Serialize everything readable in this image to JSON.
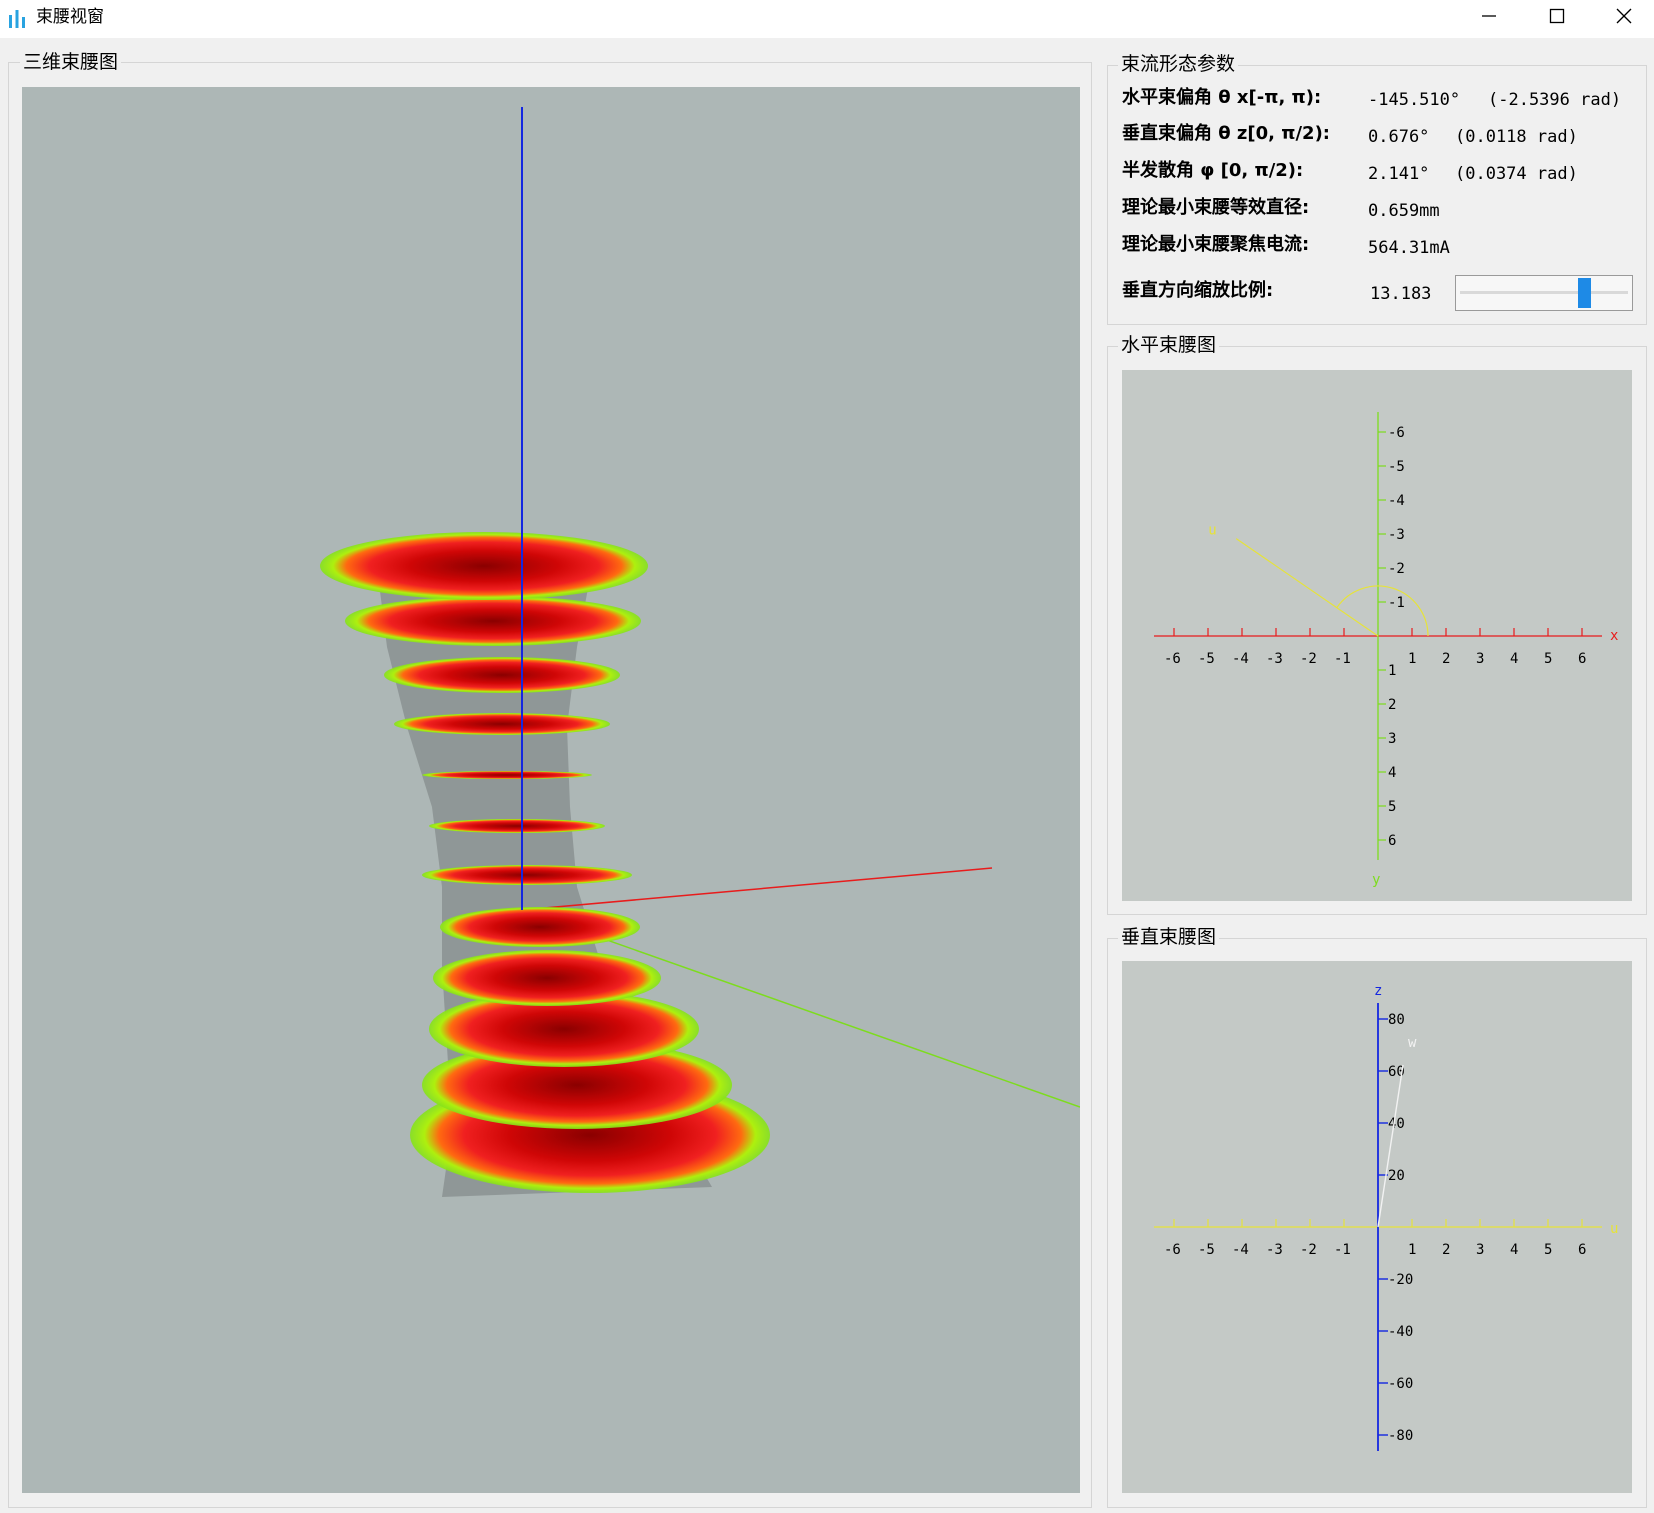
{
  "window": {
    "title": "束腰视窗",
    "icon": "bar-chart-icon",
    "controls": [
      "minimize-icon",
      "maximize-icon",
      "close-icon"
    ]
  },
  "view3d": {
    "group_title": "三维束腰图"
  },
  "params": {
    "group_title": "束流形态参数",
    "rows": [
      {
        "label": "水平束偏角 θ x[-π, π):",
        "value": "-145.510°",
        "rad": "(-2.5396 rad)"
      },
      {
        "label": "垂直束偏角 θ z[0, π/2):",
        "value": "0.676°",
        "rad": "(0.0118 rad)"
      },
      {
        "label": "半发散角 φ [0, π/2):",
        "value": "2.141°",
        "rad": "(0.0374 rad)"
      },
      {
        "label": "理论最小束腰等效直径:",
        "value": "0.659mm",
        "rad": ""
      },
      {
        "label": "理论最小束腰聚焦电流:",
        "value": "564.31mA",
        "rad": ""
      }
    ],
    "scale": {
      "label": "垂直方向缩放比例:",
      "value": "13.183",
      "slider_fraction": 0.8
    }
  },
  "horizontal_chart": {
    "group_title": "水平束腰图",
    "x_axis_label": "x",
    "y_axis_label": "y",
    "beam_label": "u",
    "beam_angle_deg": -145.51,
    "x_ticks": [
      -6,
      -5,
      -4,
      -3,
      -2,
      -1,
      1,
      2,
      3,
      4,
      5,
      6
    ],
    "y_ticks_up": [
      -1,
      -2,
      -3,
      -4,
      -5,
      -6
    ],
    "y_ticks_down": [
      1,
      2,
      3,
      4,
      5,
      6
    ]
  },
  "vertical_chart": {
    "group_title": "垂直束腰图",
    "h_axis_label": "u",
    "z_axis_label": "z",
    "beam_label": "w",
    "beam_angle_deg": 0.676,
    "x_ticks": [
      -6,
      -5,
      -4,
      -3,
      -2,
      -1,
      1,
      2,
      3,
      4,
      5,
      6
    ],
    "z_ticks_up": [
      20,
      40,
      60,
      80
    ],
    "z_ticks_down": [
      -20,
      -40,
      -60,
      -80
    ]
  },
  "colors": {
    "viewport_bg": "#adb7b6",
    "chart_bg": "#c4c9c6",
    "z_axis": "#1427e0",
    "x_axis": "#e81c1c",
    "y_axis": "#7ddc1e",
    "beam_line": "#e6e33a",
    "slider_handle": "#1e8ae6"
  }
}
